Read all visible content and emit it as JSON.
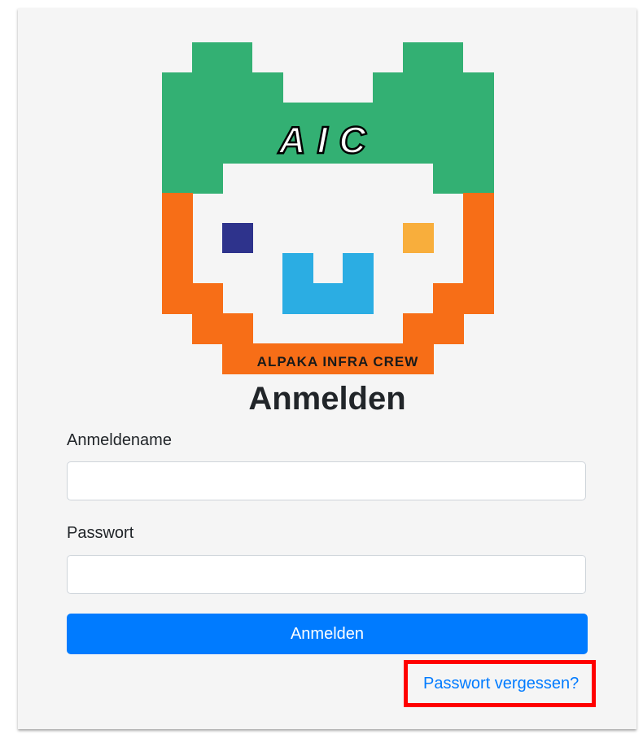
{
  "logo": {
    "top_text": "AIC",
    "bottom_text": "ALPAKA INFRA CREW",
    "colors": {
      "green": "#33b073",
      "orange": "#f76e17",
      "navy": "#2e338c",
      "yellow": "#f8ae3c",
      "blue": "#2bade3",
      "white": "#ffffff"
    }
  },
  "form": {
    "title": "Anmelden",
    "username_label": "Anmeldename",
    "username_value": "",
    "password_label": "Passwort",
    "password_value": "",
    "submit_label": "Anmelden",
    "forgot_link": "Passwort vergessen?"
  },
  "colors": {
    "primary": "#007bff",
    "highlight": "#ff0000",
    "card_background": "#f5f5f5"
  }
}
